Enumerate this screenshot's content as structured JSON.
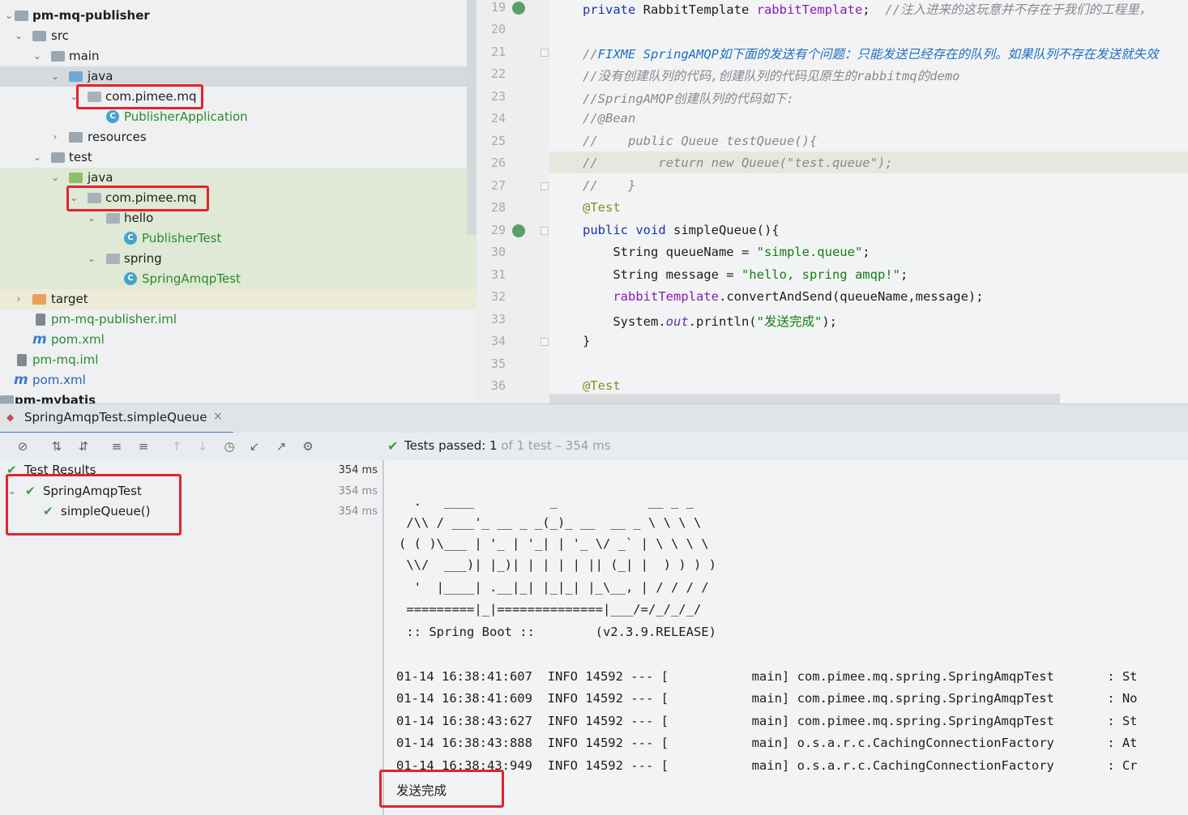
{
  "project_tree": {
    "items": [
      {
        "label": "pm-mq-publisher",
        "kind": "module"
      },
      {
        "label": "src",
        "kind": "folder"
      },
      {
        "label": "main",
        "kind": "folder"
      },
      {
        "label": "java",
        "kind": "source-root"
      },
      {
        "label": "com.pimee.mq",
        "kind": "package"
      },
      {
        "label": "PublisherApplication",
        "kind": "class"
      },
      {
        "label": "resources",
        "kind": "resources-folder"
      },
      {
        "label": "test",
        "kind": "folder"
      },
      {
        "label": "java",
        "kind": "test-root"
      },
      {
        "label": "com.pimee.mq",
        "kind": "package"
      },
      {
        "label": "hello",
        "kind": "package"
      },
      {
        "label": "PublisherTest",
        "kind": "class"
      },
      {
        "label": "spring",
        "kind": "package"
      },
      {
        "label": "SpringAmqpTest",
        "kind": "class"
      },
      {
        "label": "target",
        "kind": "excluded-folder"
      },
      {
        "label": "pm-mq-publisher.iml",
        "kind": "iml-file"
      },
      {
        "label": "pom.xml",
        "kind": "maven-file"
      },
      {
        "label": "pm-mq.iml",
        "kind": "iml-file"
      },
      {
        "label": "pom.xml",
        "kind": "maven-file"
      },
      {
        "label": "pm-mybatis",
        "kind": "module"
      }
    ]
  },
  "editor": {
    "line_numbers": [
      "19",
      "20",
      "21",
      "22",
      "23",
      "24",
      "25",
      "26",
      "27",
      "28",
      "29",
      "30",
      "31",
      "32",
      "33",
      "34",
      "35",
      "36"
    ],
    "code": {
      "l19_kw": "private",
      "l19_type": " RabbitTemplate ",
      "l19_field": "rabbitTemplate",
      "l19_semi": ";  ",
      "l19_comment": "//注入进来的这玩意并不存在于我们的工程里，",
      "l21_slashes": "//",
      "l21_todo": "FIXME SpringAMQP如下面的发送有个问题：只能发送已经存在的队列。如果队列不存在发送就失效",
      "l22": "//没有创建队列的代码,创建队列的代码见原生的rabbitmq的demo",
      "l23": "//SpringAMQP创建队列的代码如下:",
      "l24": "//@Bean",
      "l25": "//    public Queue testQueue(){",
      "l26": "//        return new Queue(\"test.queue\");",
      "l27": "//    }",
      "l28": "@Test",
      "l29_kw": "public void ",
      "l29_rest": "simpleQueue(){",
      "l30_type": "    String queueName = ",
      "l30_str": "\"simple.queue\"",
      "l30_end": ";",
      "l31_type": "    String message = ",
      "l31_str": "\"hello, spring amqp!\"",
      "l31_end": ";",
      "l32_field": "    rabbitTemplate",
      "l32_rest": ".convertAndSend(queueName,message);",
      "l33_a": "    System.",
      "l33_out": "out",
      "l33_b": ".println(",
      "l33_str": "\"发送完成\"",
      "l33_c": ");",
      "l34": "}",
      "l36": "@Test"
    }
  },
  "run_panel": {
    "tab_label": "SpringAmqpTest.simpleQueue",
    "status": {
      "prefix": "Tests passed: ",
      "passed": "1",
      "of_total": " of 1 test",
      "duration": " – 354 ms"
    },
    "results": [
      {
        "label": "Test Results",
        "time": "354 ms"
      },
      {
        "label": "SpringAmqpTest",
        "time": "354 ms"
      },
      {
        "label": "simpleQueue()",
        "time": "354 ms"
      }
    ],
    "console": {
      "banner": [
        "  .   ____          _            __ _ _",
        " /\\\\ / ___'_ __ _ _(_)_ __  __ _ \\ \\ \\ \\",
        "( ( )\\___ | '_ | '_| | '_ \\/ _` | \\ \\ \\ \\",
        " \\\\/  ___)| |_)| | | | | || (_| |  ) ) ) )",
        "  '  |____| .__|_| |_|_| |_\\__, | / / / /",
        " =========|_|==============|___/=/_/_/_/",
        " :: Spring Boot ::        (v2.3.9.RELEASE)"
      ],
      "logs": [
        "01-14 16:38:41:607  INFO 14592 --- [           main] com.pimee.mq.spring.SpringAmqpTest       : St",
        "01-14 16:38:41:609  INFO 14592 --- [           main] com.pimee.mq.spring.SpringAmqpTest       : No",
        "01-14 16:38:43:627  INFO 14592 --- [           main] com.pimee.mq.spring.SpringAmqpTest       : St",
        "01-14 16:38:43:888  INFO 14592 --- [           main] o.s.a.r.c.CachingConnectionFactory       : At",
        "01-14 16:38:43:949  INFO 14592 --- [           main] o.s.a.r.c.CachingConnectionFactory       : Cr"
      ],
      "output": "发送完成"
    }
  },
  "colors": {
    "highlight_red": "#e5232b",
    "pass_green": "#3e9a3e",
    "tab_accent": "#3d7bd6"
  }
}
